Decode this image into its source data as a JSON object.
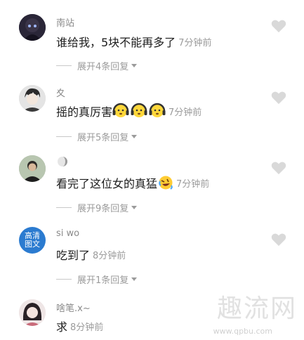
{
  "comments": [
    {
      "username": "南站",
      "text": "谁给我，5块不能再多了",
      "time": "7分钟前",
      "replies_label": "展开4条回复"
    },
    {
      "username": "夊",
      "text": "摇的真厉害",
      "emoji_count": 3,
      "time": "7分钟前",
      "replies_label": "展开5条回复"
    },
    {
      "username": "",
      "text": "看完了这位女的真猛",
      "time": "7分钟前",
      "replies_label": "展开9条回复"
    },
    {
      "username": "si wo",
      "avatar_text": "高清\n图文",
      "text": "吃到了",
      "time": "8分钟前",
      "replies_label": "展开1条回复"
    },
    {
      "username": "啥笔.x~",
      "text": "求",
      "time": "8分钟前"
    }
  ],
  "watermark": {
    "text": "趣流网",
    "url": "www.qpbu.com"
  },
  "colors": {
    "heart": "#d9d9d9",
    "username": "#8a8a8a",
    "time": "#9b9b9b"
  }
}
